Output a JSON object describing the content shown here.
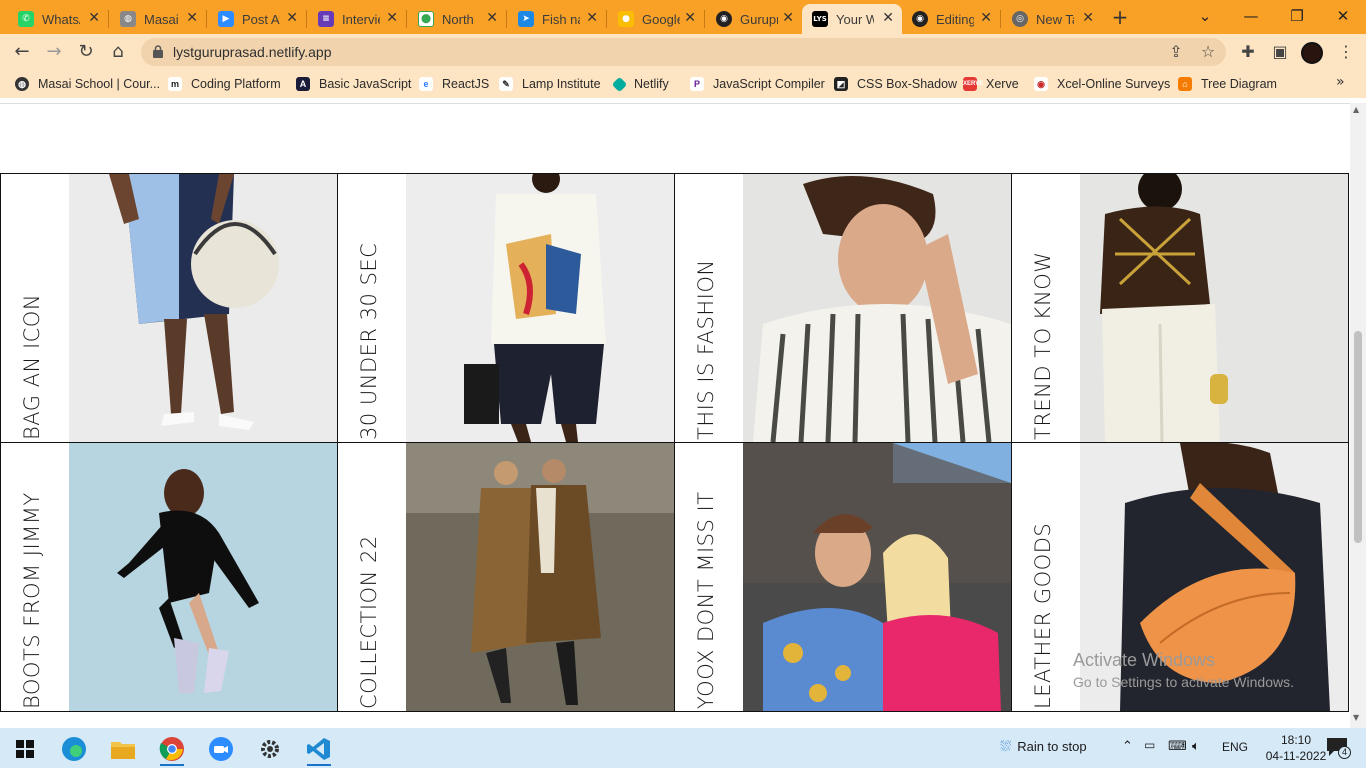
{
  "browser": {
    "tabs": [
      {
        "title": "WhatsApp",
        "icon": "whatsapp-icon",
        "color": "#25d366"
      },
      {
        "title": "Masai School",
        "icon": "globe-icon",
        "color": "#888888"
      },
      {
        "title": "Post Attendance",
        "icon": "zoom-icon",
        "color": "#2d8cff"
      },
      {
        "title": "Interview",
        "icon": "form-icon",
        "color": "#673ab7"
      },
      {
        "title": "North",
        "icon": "maps-icon",
        "color": "#34a853"
      },
      {
        "title": "Fish name",
        "icon": "fish-icon",
        "color": "#1e88e5"
      },
      {
        "title": "Google Keep",
        "icon": "keep-icon",
        "color": "#fbbc04"
      },
      {
        "title": "Guruprasad",
        "icon": "github-icon",
        "color": "#222222"
      },
      {
        "title": "Your Wardrobe",
        "icon": "lyst-icon",
        "color": "#000000",
        "active": true
      },
      {
        "title": "Editing",
        "icon": "github-icon",
        "color": "#222222"
      },
      {
        "title": "New Tab",
        "icon": "chrome-icon",
        "color": "#666666"
      }
    ],
    "url": "lystguruprasad.netlify.app",
    "bookmarks": [
      {
        "label": "Masai School | Cour...",
        "icon": "masai-icon",
        "color": "#333333"
      },
      {
        "label": "Coding Platform",
        "icon": "m-icon",
        "color": "#222222"
      },
      {
        "label": "Basic JavaScript",
        "icon": "js-icon",
        "color": "#1b1b3a"
      },
      {
        "label": "ReactJS",
        "icon": "react-icon",
        "color": "#2979ff"
      },
      {
        "label": "Lamp Institute",
        "icon": "lamp-icon",
        "color": "#333333"
      },
      {
        "label": "Netlify",
        "icon": "netlify-icon",
        "color": "#00ad9f"
      },
      {
        "label": "JavaScript Compiler",
        "icon": "compiler-icon",
        "color": "#6a1b9a"
      },
      {
        "label": "CSS Box-Shadow",
        "icon": "css-icon",
        "color": "#222222"
      },
      {
        "label": "Xerve",
        "icon": "xerve-icon",
        "color": "#e53935"
      },
      {
        "label": "Xcel-Online Surveys",
        "icon": "survey-icon",
        "color": "#c62828"
      },
      {
        "label": "Tree Diagram",
        "icon": "tree-icon",
        "color": "#f57c00"
      }
    ]
  },
  "page": {
    "tiles": [
      {
        "label": "BAG AN ICON",
        "image": "bag-photo"
      },
      {
        "label": "30 UNDER 30 SEC",
        "image": "shirt-photo"
      },
      {
        "label": "THIS IS FASHION",
        "image": "striped-shirt-photo"
      },
      {
        "label": "TREND TO KNOW",
        "image": "chain-top-photo"
      },
      {
        "label": "BOOTS FROM JIMMY",
        "image": "boots-photo"
      },
      {
        "label": "COLLECTION 22",
        "image": "coats-photo"
      },
      {
        "label": "YOOX DONT MISS IT",
        "image": "couple-photo"
      },
      {
        "label": "LEATHER GOODS",
        "image": "orange-bag-photo"
      }
    ]
  },
  "watermark": {
    "line1": "Activate Windows",
    "line2": "Go to Settings to activate Windows."
  },
  "taskbar": {
    "weather": "Rain to stop",
    "language": "ENG",
    "time": "18:10",
    "date": "04-11-2022",
    "notifications": "4"
  }
}
